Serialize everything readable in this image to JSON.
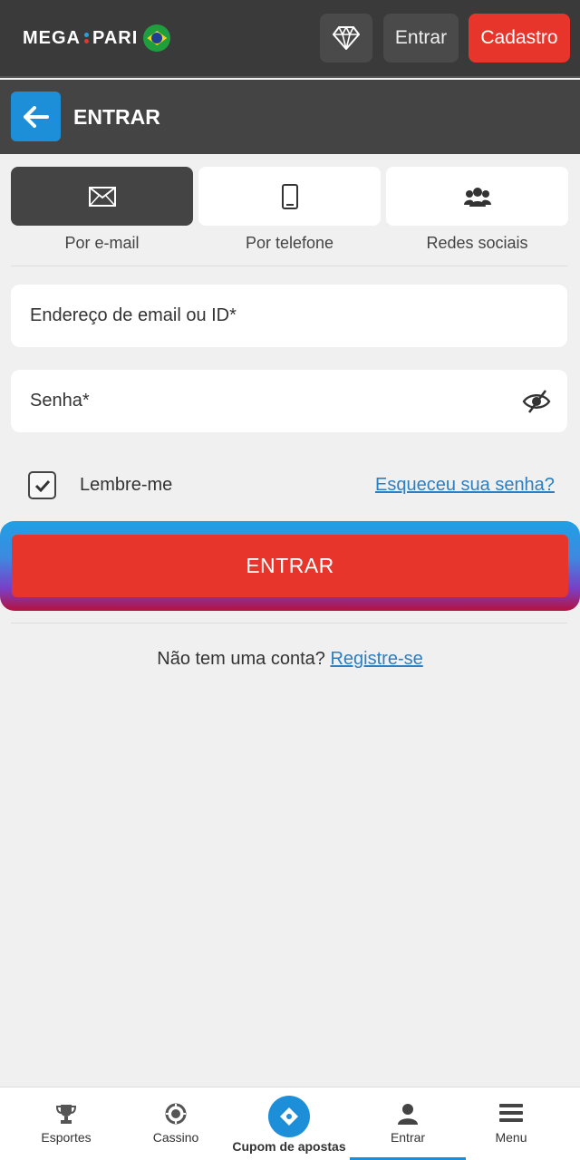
{
  "header": {
    "logo_left": "MEGA",
    "logo_right": "PARI",
    "enter_label": "Entrar",
    "register_label": "Cadastro"
  },
  "subheader": {
    "title": "ENTRAR"
  },
  "tabs": [
    {
      "label": "Por e-mail",
      "icon": "envelope-icon",
      "active": true
    },
    {
      "label": "Por telefone",
      "icon": "phone-icon",
      "active": false
    },
    {
      "label": "Redes sociais",
      "icon": "users-icon",
      "active": false
    }
  ],
  "form": {
    "email_placeholder": "Endereço de email ou ID*",
    "password_placeholder": "Senha*",
    "remember_label": "Lembre-me",
    "remember_checked": true,
    "forgot_label": "Esqueceu sua senha?",
    "submit_label": "ENTRAR"
  },
  "signup": {
    "prompt": "Não tem uma conta?",
    "link": "Registre-se"
  },
  "bottom_nav": [
    {
      "label": "Esportes",
      "icon": "trophy-icon"
    },
    {
      "label": "Cassino",
      "icon": "casino-chip-icon"
    },
    {
      "label": "Cupom de apostas",
      "icon": "ticket-icon"
    },
    {
      "label": "Entrar",
      "icon": "user-icon",
      "active": true
    },
    {
      "label": "Menu",
      "icon": "hamburger-icon"
    }
  ],
  "colors": {
    "accent_red": "#e8352b",
    "accent_blue": "#1d8fd8",
    "header_bg": "#3a3a3a"
  }
}
